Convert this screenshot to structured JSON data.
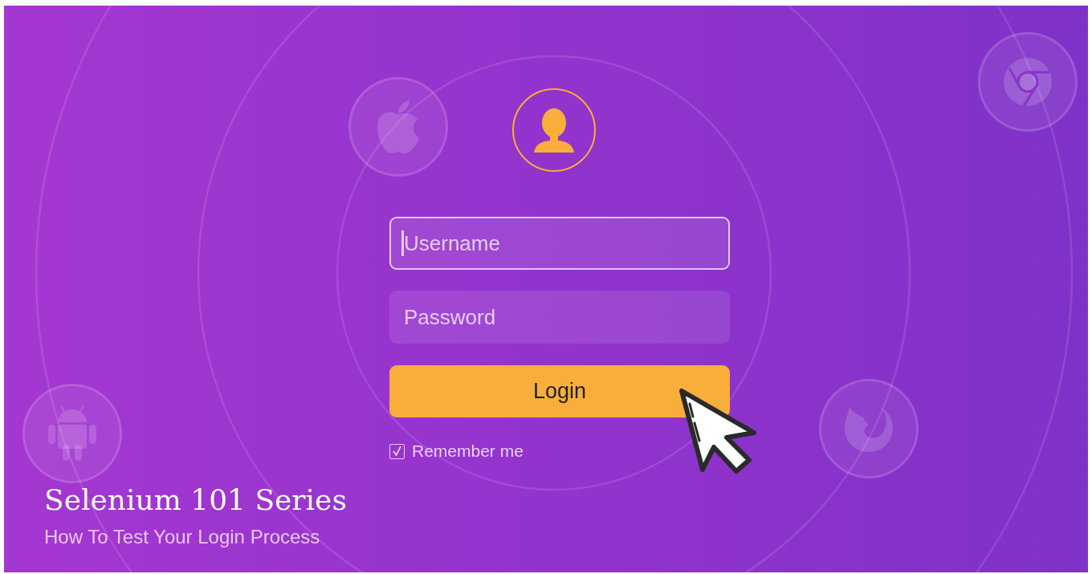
{
  "form": {
    "fields": [
      {
        "placeholder": "Username",
        "focused": true
      },
      {
        "placeholder": "Password",
        "focused": false
      }
    ],
    "login_button": {
      "label": "Login"
    },
    "remember": {
      "label": "Remember me",
      "checked": true
    }
  },
  "caption": {
    "title": "Selenium 101 Series",
    "subtitle": "How To Test Your Login Process"
  }
}
